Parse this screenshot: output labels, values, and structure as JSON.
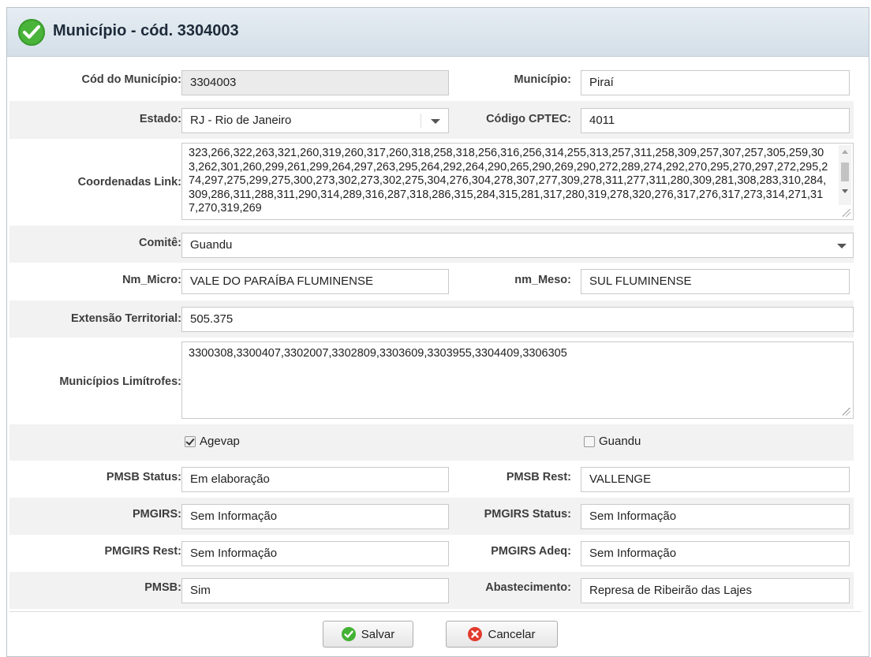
{
  "dialog": {
    "title": "Município - cód. 3304003",
    "title_icon": "check-circle-icon"
  },
  "fields": {
    "cod_municipio": {
      "label": "Cód do Município:",
      "value": "3304003"
    },
    "municipio": {
      "label": "Município:",
      "value": "Piraí"
    },
    "estado": {
      "label": "Estado:",
      "value": "RJ - Rio de Janeiro"
    },
    "codigo_cptec": {
      "label": "Código CPTEC:",
      "value": "4011"
    },
    "coordenadas_link": {
      "label": "Coordenadas Link:",
      "value": "323,266,322,263,321,260,319,260,317,260,318,258,318,256,316,256,314,255,313,257,311,258,309,257,307,257,305,259,303,262,301,260,299,261,299,264,297,263,295,264,292,264,290,265,290,269,290,272,289,274,292,270,295,270,297,272,295,274,297,275,299,275,300,273,302,273,302,275,304,276,304,278,307,277,309,278,311,277,311,280,309,281,308,283,310,284,309,286,311,288,311,290,314,289,316,287,318,286,315,284,315,281,317,280,319,278,320,276,317,276,317,273,314,271,317,270,319,269"
    },
    "comite": {
      "label": "Comitê:",
      "value": "Guandu"
    },
    "nm_micro": {
      "label": "Nm_Micro:",
      "value": "VALE DO PARAÍBA FLUMINENSE"
    },
    "nm_meso": {
      "label": "nm_Meso:",
      "value": "SUL FLUMINENSE"
    },
    "extensao": {
      "label": "Extensão Territorial:",
      "value": "505.375"
    },
    "limitrofes": {
      "label": "Municípios Limítrofes:",
      "value": "3300308,3300407,3302007,3302809,3303609,3303955,3304409,3306305"
    },
    "agevap": {
      "label": "Agevap",
      "checked": true
    },
    "guandu": {
      "label": "Guandu",
      "checked": false
    },
    "pmsb_status": {
      "label": "PMSB Status:",
      "value": "Em elaboração"
    },
    "pmsb_rest": {
      "label": "PMSB Rest:",
      "value": "VALLENGE"
    },
    "pmgirs": {
      "label": "PMGIRS:",
      "value": "Sem Informação"
    },
    "pmgirs_status": {
      "label": "PMGIRS Status:",
      "value": "Sem Informação"
    },
    "pmgirs_rest": {
      "label": "PMGIRS Rest:",
      "value": "Sem Informação"
    },
    "pmgirs_adeq": {
      "label": "PMGIRS Adeq:",
      "value": "Sem Informação"
    },
    "pmsb": {
      "label": "PMSB:",
      "value": "Sim"
    },
    "abastecimento": {
      "label": "Abastecimento:",
      "value": "Represa de Ribeirão das Lajes"
    }
  },
  "buttons": {
    "save": {
      "label": "Salvar",
      "icon": "check-circle-icon",
      "color": "#43b133"
    },
    "cancel": {
      "label": "Cancelar",
      "icon": "cancel-circle-icon",
      "color": "#e23b2e"
    }
  }
}
